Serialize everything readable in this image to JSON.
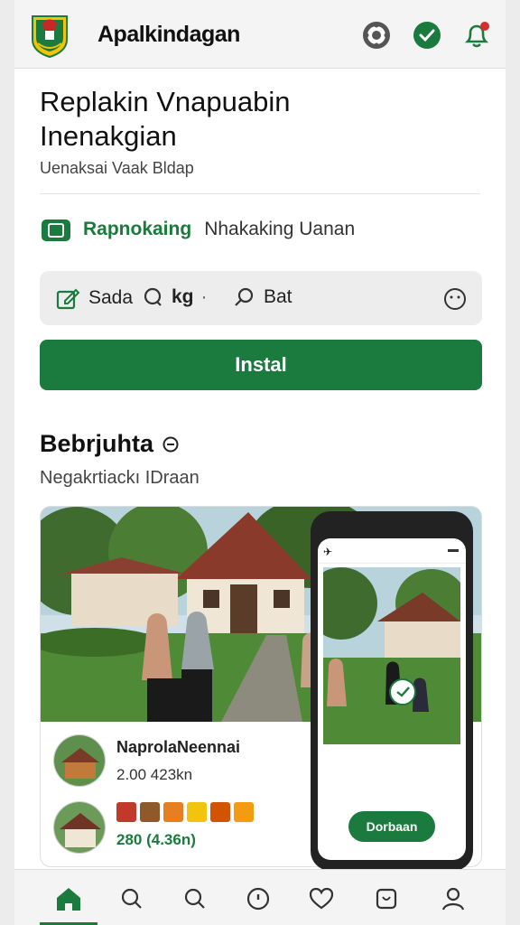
{
  "app": {
    "title": "Apalkindagan"
  },
  "header": {
    "title_line1": "Replakin Vnapuabin",
    "title_line2": "Inenakgian",
    "subtitle": "Uenaksai Vaak Bldap"
  },
  "feature": {
    "label": "Rapnokaing",
    "description": "Nhakaking Uanan"
  },
  "search_bar": {
    "item1": "Sada",
    "item2": "kg",
    "item2_suffix": "·",
    "item3": "Bat"
  },
  "install_button": "Instal",
  "section": {
    "title": "Bebrjuhta",
    "subtitle": "Negakrtiackı IDraan"
  },
  "listing": {
    "rows": [
      {
        "name": "NaprolaNeennai",
        "meta": "2.00 423kn"
      },
      {
        "name": "",
        "meta": "280 (4.36n)"
      }
    ],
    "menu_glyph": "⋮"
  },
  "phone_preview": {
    "button_label": "Dorbaan"
  },
  "colors": {
    "accent": "#1b7a3d",
    "notification": "#d32f2f"
  },
  "icons": [
    "logo-emblem",
    "settings-icon",
    "verified-check-icon",
    "bell-icon",
    "home-icon",
    "search-icon",
    "compass-icon",
    "heart-icon",
    "bag-icon",
    "profile-icon"
  ]
}
